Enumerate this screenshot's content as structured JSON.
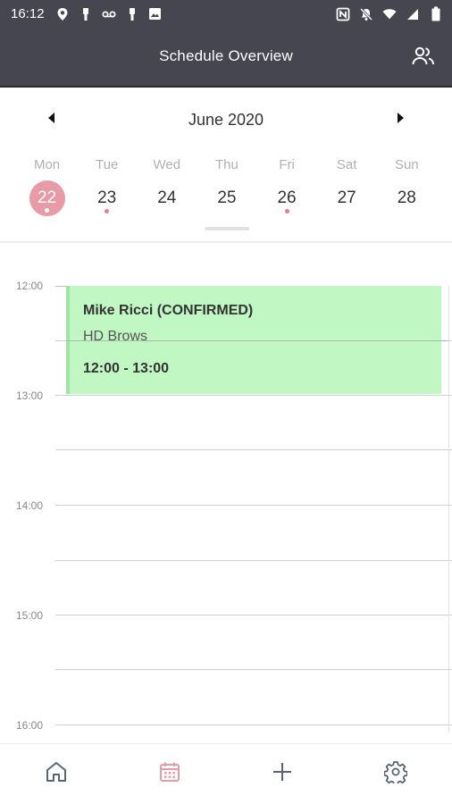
{
  "status_bar": {
    "time": "16:12",
    "left_icons": [
      "location-pin-icon",
      "usb-icon",
      "voicemail-icon",
      "usb-icon",
      "image-icon"
    ],
    "right_icons": [
      "nfc-icon",
      "mute-icon",
      "wifi-icon",
      "signal-icon",
      "battery-icon"
    ]
  },
  "app_bar": {
    "title": "Schedule Overview",
    "action_icon": "people-icon"
  },
  "calendar": {
    "month_label": "June 2020",
    "days": [
      {
        "name": "Mon",
        "num": "22",
        "selected": true,
        "has_event": true
      },
      {
        "name": "Tue",
        "num": "23",
        "selected": false,
        "has_event": true
      },
      {
        "name": "Wed",
        "num": "24",
        "selected": false,
        "has_event": false
      },
      {
        "name": "Thu",
        "num": "25",
        "selected": false,
        "has_event": false
      },
      {
        "name": "Fri",
        "num": "26",
        "selected": false,
        "has_event": true
      },
      {
        "name": "Sat",
        "num": "27",
        "selected": false,
        "has_event": false
      },
      {
        "name": "Sun",
        "num": "28",
        "selected": false,
        "has_event": false
      }
    ]
  },
  "timeline": {
    "hours": [
      "12:00",
      "13:00",
      "14:00",
      "15:00",
      "16:00"
    ],
    "event": {
      "title": "Mike Ricci (CONFIRMED)",
      "service": "HD Brows",
      "time": "12:00 - 13:00"
    }
  },
  "bottom_nav": {
    "items": [
      {
        "name": "home",
        "icon": "home-icon"
      },
      {
        "name": "schedule",
        "icon": "calendar-icon",
        "active": true
      },
      {
        "name": "add",
        "icon": "plus-icon"
      },
      {
        "name": "settings",
        "icon": "gear-icon"
      }
    ]
  },
  "colors": {
    "app_bar": "#45464f",
    "accent_pink": "#e89aa6",
    "event_green": "#c0f7c3"
  }
}
